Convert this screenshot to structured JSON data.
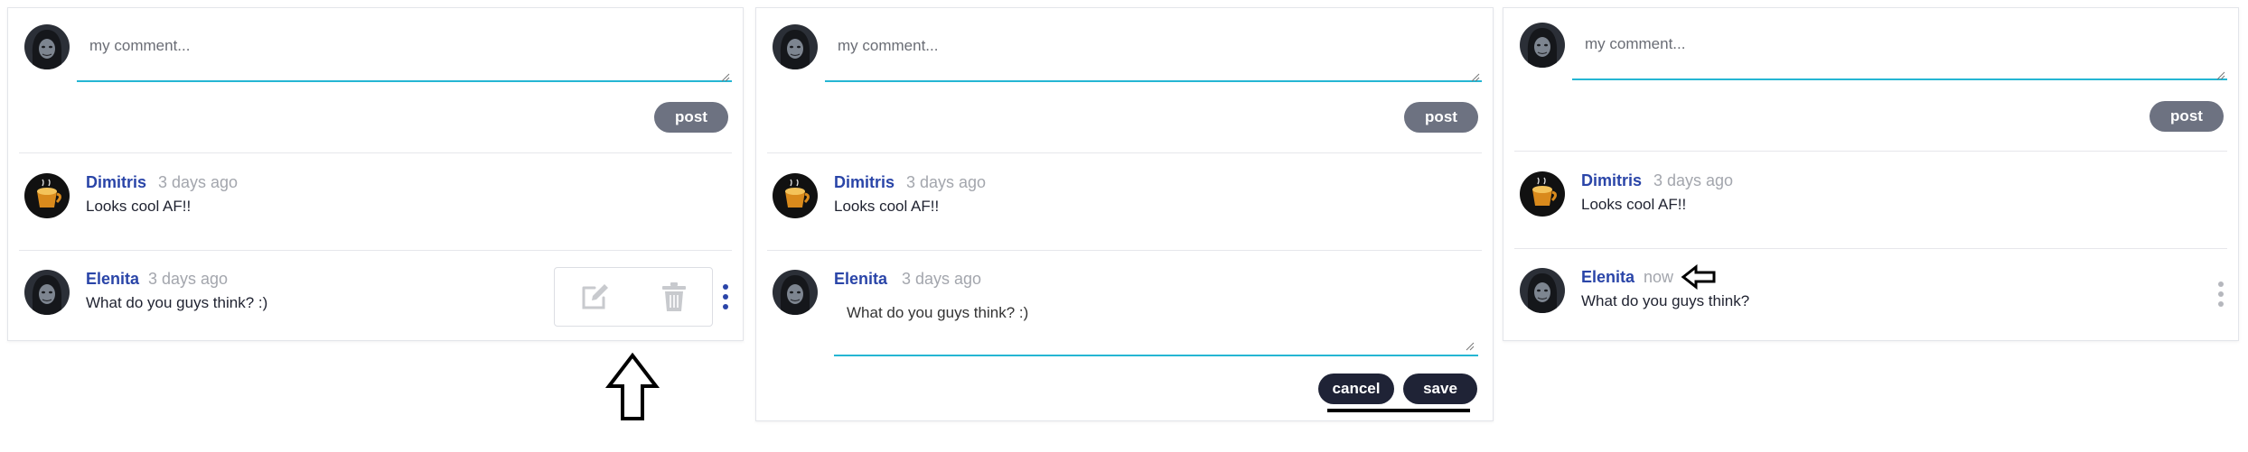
{
  "colors": {
    "accent_underline": "#25b6d3",
    "author_name": "#2a45a8",
    "post_button": "#6d7281",
    "dark_button": "#1f2336",
    "kebab_active": "#2a45a8",
    "kebab_idle": "#b5b7bd"
  },
  "composer": {
    "placeholder": "my comment...",
    "post_label": "post",
    "avatar_icon": "hooded-user-avatar-icon"
  },
  "comments": [
    {
      "author": "Dimitris",
      "time": "3 days ago",
      "text": "Looks cool AF!!",
      "avatar_icon": "coffee-cup-avatar-icon"
    },
    {
      "author": "Elenita",
      "time": "3 days ago",
      "text": "What do you guys think? :)",
      "avatar_icon": "hooded-user-avatar-icon"
    }
  ],
  "panels": {
    "hover_state": {
      "actions": [
        "edit-icon",
        "trash-icon"
      ],
      "annotation_icon": "up-arrow-outline-icon"
    },
    "edit_state": {
      "edit_value": "What do you guys think? :)",
      "cancel_label": "cancel",
      "save_label": "save"
    },
    "edited_state": {
      "comment": {
        "author": "Elenita",
        "time": "now",
        "text": "What do you guys think?"
      },
      "annotation_icon": "left-arrow-outline-icon"
    }
  }
}
